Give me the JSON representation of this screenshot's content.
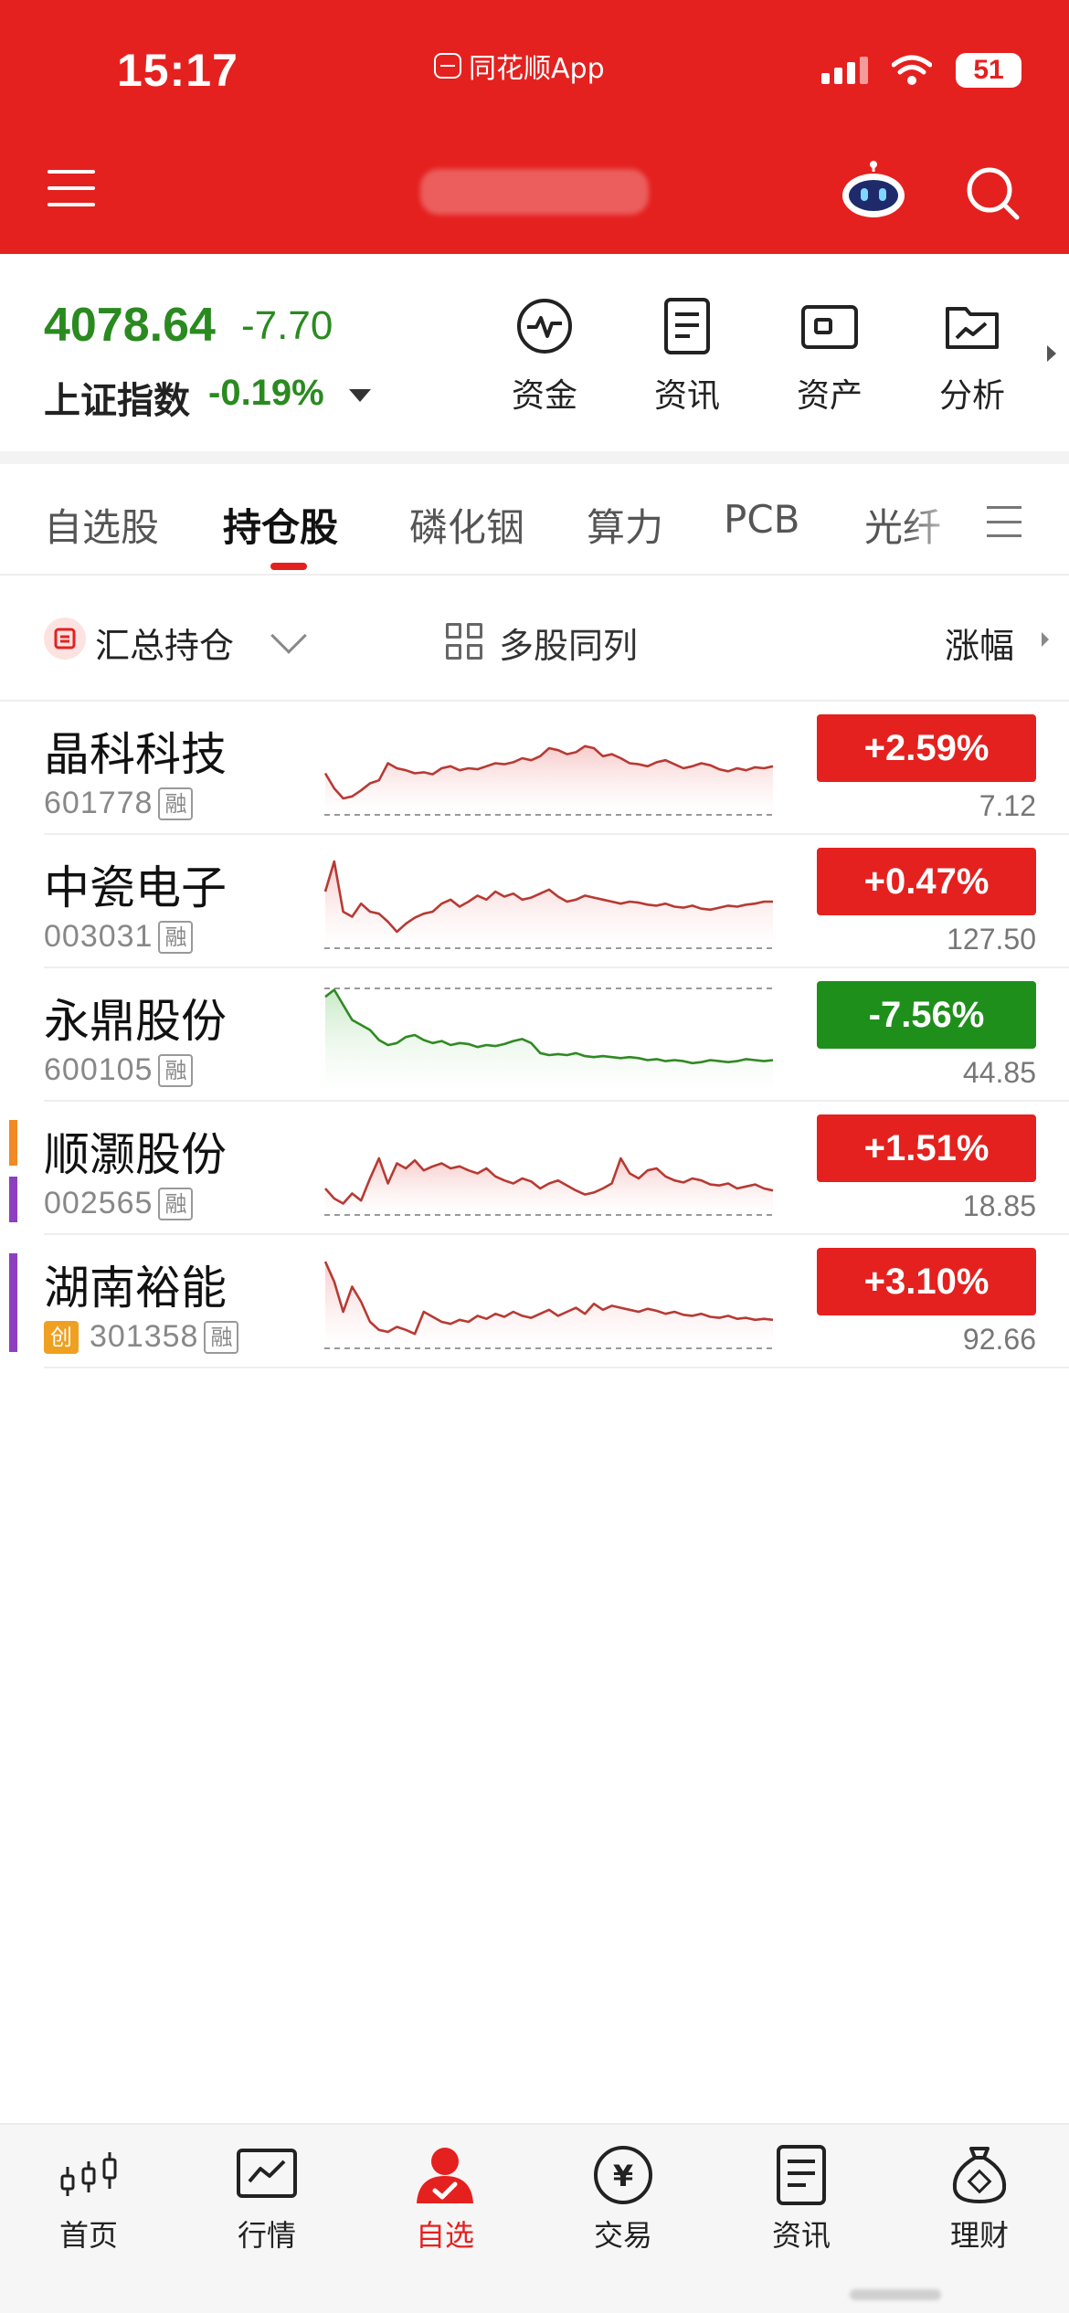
{
  "status_bar": {
    "time": "15:17",
    "app_name": "同花顺App",
    "battery": "51"
  },
  "index": {
    "value": "4078.64",
    "change": "-7.70",
    "name": "上证指数",
    "percent": "-0.19%",
    "color": "#2a8a20"
  },
  "quick_actions": [
    {
      "label": "资金",
      "icon": "pulse-circle-icon"
    },
    {
      "label": "资讯",
      "icon": "document-icon"
    },
    {
      "label": "资产",
      "icon": "wallet-icon"
    },
    {
      "label": "分析",
      "icon": "analysis-folder-icon"
    }
  ],
  "tabs": [
    {
      "label": "自选股",
      "active": false
    },
    {
      "label": "持仓股",
      "active": true
    },
    {
      "label": "磷化铟",
      "active": false
    },
    {
      "label": "算力",
      "active": false
    },
    {
      "label": "PCB",
      "active": false
    },
    {
      "label": "光纤",
      "active": false
    }
  ],
  "toolbar": {
    "summary_label": "汇总持仓",
    "multi_label": "多股同列",
    "sort_label": "涨幅"
  },
  "stocks": [
    {
      "name": "晶科科技",
      "code": "601778",
      "margin_tag": "融",
      "board_tag": "",
      "change": "+2.59%",
      "price": "7.12",
      "direction": "up",
      "marks": [],
      "trend": [
        45,
        30,
        20,
        22,
        28,
        35,
        38,
        55,
        50,
        48,
        45,
        46,
        44,
        50,
        52,
        48,
        50,
        49,
        52,
        55,
        54,
        56,
        60,
        58,
        62,
        70,
        68,
        64,
        66,
        72,
        70,
        62,
        64,
        60,
        55,
        54,
        52,
        56,
        58,
        54,
        50,
        52,
        55,
        53,
        49,
        47,
        50,
        48,
        51,
        50,
        52
      ]
    },
    {
      "name": "中瓷电子",
      "code": "003031",
      "margin_tag": "融",
      "board_tag": "",
      "change": "+0.47%",
      "price": "127.50",
      "direction": "up",
      "marks": [],
      "trend": [
        60,
        90,
        40,
        35,
        48,
        40,
        38,
        30,
        20,
        28,
        34,
        38,
        40,
        48,
        52,
        45,
        50,
        56,
        52,
        60,
        55,
        58,
        52,
        54,
        58,
        62,
        55,
        50,
        52,
        56,
        54,
        52,
        50,
        48,
        50,
        49,
        47,
        46,
        48,
        45,
        44,
        46,
        43,
        42,
        44,
        46,
        45,
        47,
        48,
        50,
        50
      ]
    },
    {
      "name": "永鼎股份",
      "code": "600105",
      "margin_tag": "融",
      "board_tag": "",
      "change": "-7.56%",
      "price": "44.85",
      "direction": "down",
      "marks": [],
      "trend": [
        88,
        95,
        80,
        65,
        60,
        55,
        45,
        40,
        42,
        48,
        50,
        45,
        42,
        44,
        40,
        42,
        41,
        38,
        40,
        39,
        41,
        44,
        46,
        42,
        32,
        30,
        31,
        30,
        32,
        29,
        28,
        29,
        28,
        27,
        28,
        27,
        25,
        26,
        24,
        25,
        24,
        22,
        23,
        25,
        24,
        23,
        24,
        26,
        25,
        24,
        25
      ]
    },
    {
      "name": "顺灏股份",
      "code": "002565",
      "margin_tag": "融",
      "board_tag": "",
      "change": "+1.51%",
      "price": "18.85",
      "direction": "up",
      "marks": [
        "#f08a24",
        "#8e3fbf"
      ],
      "trend": [
        30,
        20,
        15,
        25,
        18,
        40,
        60,
        35,
        55,
        50,
        58,
        48,
        52,
        55,
        50,
        52,
        48,
        45,
        50,
        42,
        38,
        35,
        40,
        37,
        30,
        35,
        38,
        33,
        28,
        24,
        26,
        30,
        35,
        60,
        45,
        40,
        48,
        50,
        42,
        38,
        36,
        40,
        38,
        34,
        33,
        35,
        30,
        32,
        34,
        30,
        28
      ]
    },
    {
      "name": "湖南裕能",
      "code": "301358",
      "margin_tag": "融",
      "board_tag": "创",
      "change": "+3.10%",
      "price": "92.66",
      "direction": "up",
      "marks": [
        "#8e3fbf"
      ],
      "trend": [
        90,
        70,
        40,
        65,
        50,
        30,
        22,
        20,
        25,
        22,
        18,
        40,
        35,
        30,
        28,
        32,
        30,
        36,
        33,
        38,
        35,
        40,
        36,
        34,
        38,
        42,
        36,
        40,
        44,
        38,
        48,
        42,
        46,
        44,
        42,
        40,
        43,
        41,
        38,
        40,
        37,
        36,
        38,
        35,
        34,
        36,
        33,
        34,
        32,
        33,
        32
      ]
    }
  ],
  "bottom_nav": [
    {
      "label": "首页",
      "icon": "candlestick-icon",
      "active": false
    },
    {
      "label": "行情",
      "icon": "market-chart-icon",
      "active": false
    },
    {
      "label": "自选",
      "icon": "watchlist-user-icon",
      "active": true
    },
    {
      "label": "交易",
      "icon": "yuan-coin-icon",
      "active": false
    },
    {
      "label": "资讯",
      "icon": "news-document-icon",
      "active": false
    },
    {
      "label": "理财",
      "icon": "money-bag-icon",
      "active": false
    }
  ],
  "colors": {
    "brand_red": "#e4211f",
    "up": "#e4211f",
    "down": "#1f8f1c",
    "up_line": "#b73a33",
    "down_line": "#2f8a22"
  }
}
